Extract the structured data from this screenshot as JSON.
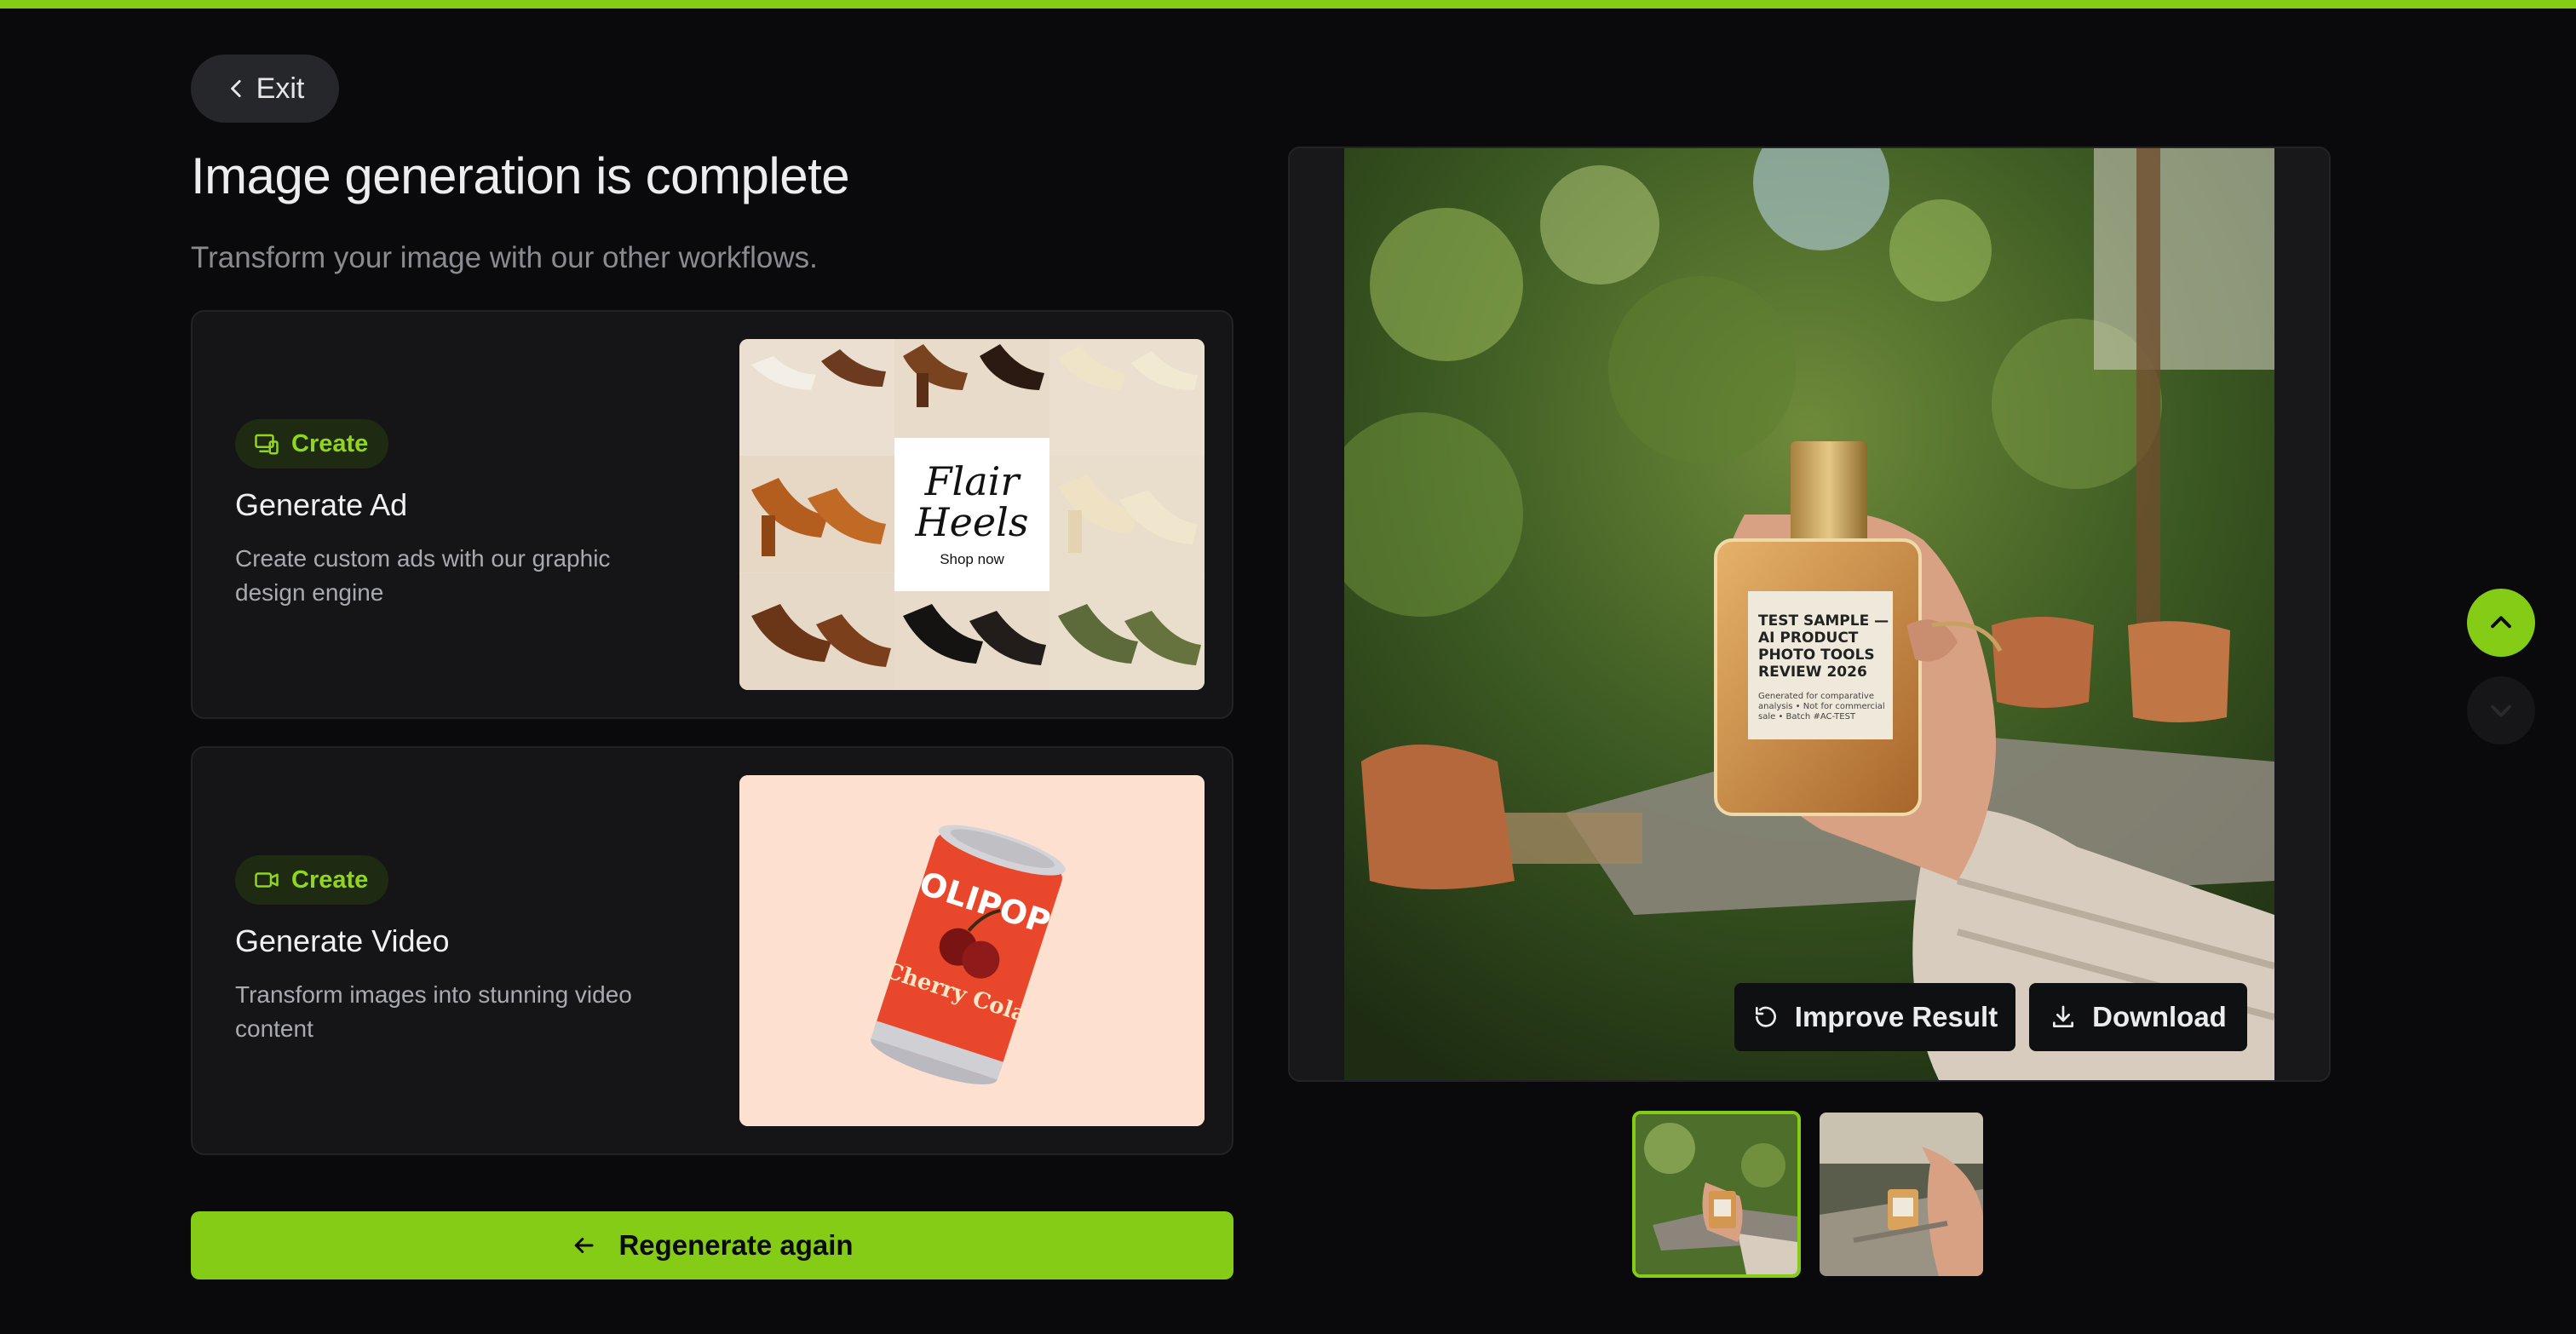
{
  "colors": {
    "accent": "#84cc16",
    "background": "#0a0a0c",
    "card": "#151518"
  },
  "header": {
    "exit_label": "Exit",
    "title": "Image generation is complete",
    "subtitle": "Transform your image with our other workflows."
  },
  "workflows": [
    {
      "badge": "Create",
      "badge_icon": "devices-icon",
      "title": "Generate Ad",
      "description": "Create custom ads with our graphic design engine",
      "thumbnail": {
        "brand": "Flair Heels",
        "cta": "Shop now"
      }
    },
    {
      "badge": "Create",
      "badge_icon": "video-camera-icon",
      "title": "Generate Video",
      "description": "Transform images into stunning video content",
      "thumbnail": {
        "brand": "OLIPOP",
        "flavor": "Cherry Cola"
      }
    }
  ],
  "regenerate_label": "Regenerate again",
  "preview": {
    "label_lines": [
      "TEST SAMPLE —",
      "AI PRODUCT",
      "PHOTO TOOLS",
      "REVIEW 2026"
    ],
    "fine_print_lines": [
      "Generated for comparative",
      "analysis • Not for commercial",
      "sale • Batch #AC-TEST"
    ],
    "improve_label": "Improve Result",
    "download_label": "Download"
  },
  "thumbnails": {
    "count": 2,
    "selected_index": 0
  }
}
